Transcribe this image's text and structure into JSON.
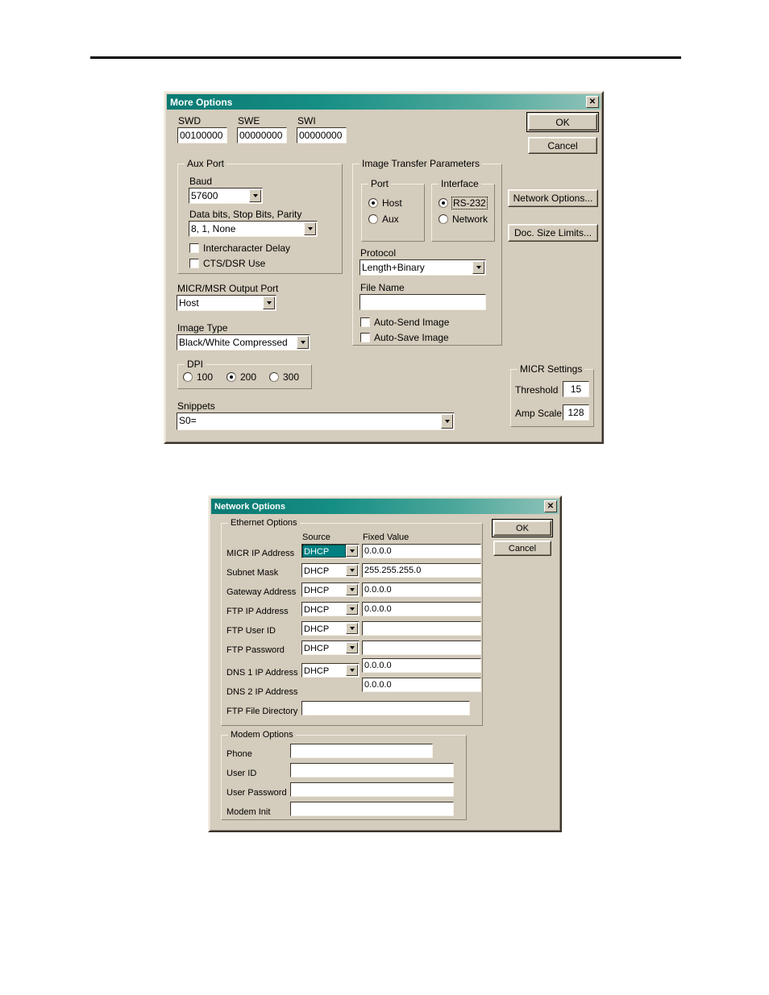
{
  "page": {
    "rule": "horizontal-rule"
  },
  "more_options": {
    "title": "More Options",
    "close_icon": "close-icon",
    "sw_fields": [
      {
        "label": "SWD",
        "value": "00100000"
      },
      {
        "label": "SWE",
        "value": "00000000"
      },
      {
        "label": "SWI",
        "value": "00000000"
      }
    ],
    "ok_label": "OK",
    "cancel_label": "Cancel",
    "network_options_label": "Network Options...",
    "doc_size_limits_label": "Doc. Size Limits...",
    "aux_port": {
      "title": "Aux Port",
      "baud_label": "Baud",
      "baud_value": "57600",
      "data_bits_label": "Data bits, Stop Bits, Parity",
      "data_bits_value": "8, 1, None",
      "intercharacter_delay_label": "Intercharacter Delay",
      "intercharacter_delay_checked": false,
      "cts_dsr_label": "CTS/DSR Use",
      "cts_dsr_checked": false
    },
    "micr_msr_output_port": {
      "label": "MICR/MSR Output Port",
      "value": "Host"
    },
    "image_type": {
      "label": "Image Type",
      "value": "Black/White Compressed"
    },
    "image_transfer": {
      "title": "Image Transfer Parameters",
      "port": {
        "title": "Port",
        "options": [
          "Host",
          "Aux"
        ],
        "selected": "Host"
      },
      "interface": {
        "title": "Interface",
        "options": [
          "RS-232",
          "Network"
        ],
        "selected": "RS-232"
      },
      "protocol_label": "Protocol",
      "protocol_value": "Length+Binary",
      "file_name_label": "File Name",
      "file_name_value": "",
      "auto_send_label": "Auto-Send Image",
      "auto_send_checked": false,
      "auto_save_label": "Auto-Save Image",
      "auto_save_checked": false
    },
    "dpi": {
      "title": "DPI",
      "options": [
        "100",
        "200",
        "300"
      ],
      "selected": "200"
    },
    "snippets": {
      "label": "Snippets",
      "value": "S0="
    },
    "micr_settings": {
      "title": "MICR Settings",
      "threshold_label": "Threshold",
      "threshold_value": "15",
      "amp_scale_label": "Amp Scale",
      "amp_scale_value": "128"
    }
  },
  "network_options": {
    "title": "Network Options",
    "close_icon": "close-icon",
    "ok_label": "OK",
    "cancel_label": "Cancel",
    "ethernet": {
      "title": "Ethernet Options",
      "col_source": "Source",
      "col_fixed_value": "Fixed Value",
      "rows": [
        {
          "label": "MICR IP Address",
          "source": "DHCP",
          "value": "0.0.0.0",
          "source_selected": true
        },
        {
          "label": "Subnet Mask",
          "source": "DHCP",
          "value": "255.255.255.0",
          "source_selected": false
        },
        {
          "label": "Gateway Address",
          "source": "DHCP",
          "value": "0.0.0.0",
          "source_selected": false
        },
        {
          "label": "FTP IP Address",
          "source": "DHCP",
          "value": "0.0.0.0",
          "source_selected": false
        },
        {
          "label": "FTP User ID",
          "source": "DHCP",
          "value": "",
          "source_selected": false
        },
        {
          "label": "FTP Password",
          "source": "DHCP",
          "value": "",
          "source_selected": false
        },
        {
          "label": "DNS 1 IP Address",
          "source": "DHCP",
          "value": "0.0.0.0",
          "source_selected": false
        },
        {
          "label": "DNS 2 IP Address",
          "source": "",
          "value": "0.0.0.0",
          "source_selected": false
        },
        {
          "label": "FTP File Directory",
          "source": "",
          "value": "",
          "source_selected": false
        }
      ]
    },
    "modem": {
      "title": "Modem Options",
      "rows": [
        {
          "label": "Phone",
          "value": ""
        },
        {
          "label": "User ID",
          "value": ""
        },
        {
          "label": "User Password",
          "value": ""
        },
        {
          "label": "Modem Init",
          "value": ""
        }
      ]
    }
  }
}
